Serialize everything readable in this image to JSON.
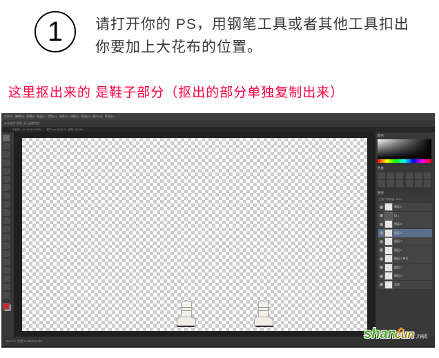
{
  "step": {
    "number": "1",
    "instruction": "请打开你的 PS，用钢笔工具或者其他工具扣出你要加上大花布的位置。"
  },
  "highlight_note": "这里抠出来的 是鞋子部分（抠出的部分单独复制出来）",
  "ps": {
    "menu": [
      "文件(F)",
      "编辑(E)",
      "图像(I)",
      "图层(L)",
      "类型(Y)",
      "选择(S)",
      "滤镜(T)",
      "视图(V)",
      "窗口(W)",
      "帮助(H)"
    ],
    "options": [
      "自动选择",
      "图层",
      "显示变换控件"
    ],
    "tabs": [
      "未标题-1 @ 100% (RGB/8)",
      "鞋子.psd @ 66.7% (图层, RGB/8)"
    ],
    "panels": {
      "color": "颜色",
      "swatches": "色板",
      "adjust": "调整",
      "layers": "图层",
      "blend": "正常",
      "opacity": "不透明度: 100%"
    },
    "layers": [
      {
        "name": "图层 6"
      },
      {
        "name": "组 1"
      },
      {
        "name": "图层 5"
      },
      {
        "name": "图层 4"
      },
      {
        "name": "图层 3"
      },
      {
        "name": "图层 2"
      },
      {
        "name": "图层 2 拷贝"
      },
      {
        "name": "图层 1"
      },
      {
        "name": "图层 0"
      },
      {
        "name": "背景"
      }
    ],
    "status": "66.67%  文档:2.25M/12.4M"
  },
  "watermark": {
    "a": "shan",
    "b": "cun",
    "c": ".net"
  }
}
